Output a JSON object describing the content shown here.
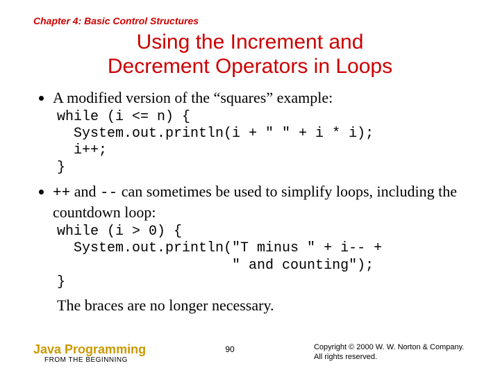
{
  "chapter": "Chapter 4: Basic Control Structures",
  "title_line1": "Using the Increment and",
  "title_line2": "Decrement Operators in Loops",
  "bullet1": "A modified version of the “squares” example:",
  "code1": "while (i <= n) {\n  System.out.println(i + \" \" + i * i);\n  i++;\n}",
  "bullet2_pre": "",
  "bullet2_op1": "++",
  "bullet2_mid": " and ",
  "bullet2_op2": "--",
  "bullet2_post": " can sometimes be used to simplify loops, including the countdown loop:",
  "code2": "while (i > 0) {\n  System.out.println(\"T minus \" + i-- +\n                     \" and counting\");\n}",
  "closing": "The braces are no longer necessary.",
  "footer": {
    "brand_main": "Java Programming",
    "brand_sub": "FROM THE BEGINNING",
    "page": "90",
    "copyright_l1": "Copyright © 2000 W. W. Norton & Company.",
    "copyright_l2": "All rights reserved."
  }
}
